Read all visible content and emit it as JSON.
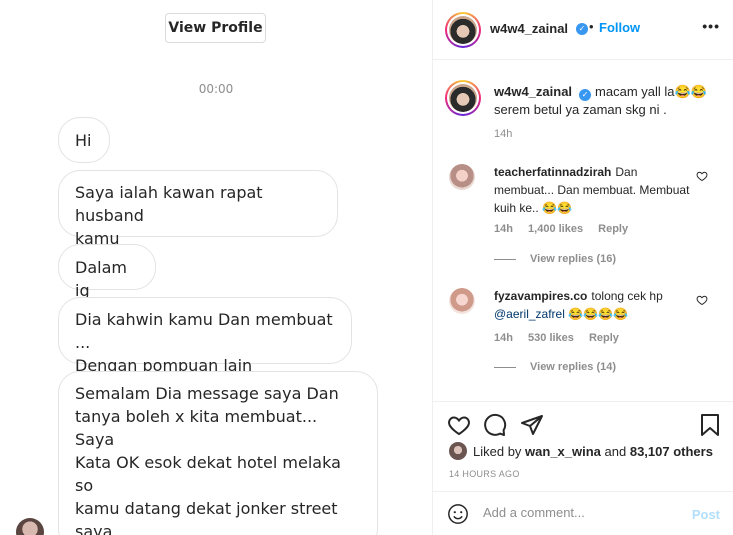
{
  "chat": {
    "view_profile": "View Profile",
    "timestamp": "00:00",
    "messages": [
      "Hi",
      "Saya ialah kawan rapat husband\nkamu",
      "Dalam ig",
      "Dia kahwin kamu Dan membuat ...\nDengan pompuan lain",
      "Semalam Dia message saya Dan\ntanya boleh x kita membuat... Saya\nKata OK esok dekat hotel melaka so\nkamu datang dekat jonker street saya\njumpa kamu pastu kamu tengok\nhusband kamu bogel dalam bilik\nhotel"
    ]
  },
  "post": {
    "header": {
      "username": "w4w4_zainal",
      "verified_icon": "verified-badge-icon",
      "separator": "•",
      "follow_label": "Follow",
      "more_label": "•••"
    },
    "caption": {
      "username": "w4w4_zainal",
      "text": "macam yall la😂😂\nserem betul ya zaman skg ni .",
      "time": "14h"
    },
    "comments": [
      {
        "username": "teacherfatinnadzirah",
        "text": "Dan membuat... Dan membuat. Membuat kuih ke.. 😂😂",
        "time": "14h",
        "likes": "1,400 likes",
        "reply_label": "Reply",
        "view_replies": "View replies (16)"
      },
      {
        "username": "fyzavampires.co",
        "text_before": "tolong cek hp",
        "mention": "@aeril_zafrel",
        "text_after": " 😂😂😂😂",
        "time": "14h",
        "likes": "530 likes",
        "reply_label": "Reply",
        "view_replies": "View replies (14)"
      }
    ],
    "likes_line": {
      "prefix": "Liked by ",
      "user": "wan_x_wina",
      "middle": " and ",
      "count": "83,107 others"
    },
    "posted_time": "14 HOURS AGO",
    "comment_placeholder": "Add a comment...",
    "post_label": "Post"
  },
  "colors": {
    "link_blue": "#0095f6",
    "post_disabled": "#b2dffc",
    "muted": "#8e8e8e",
    "text": "#262626"
  }
}
